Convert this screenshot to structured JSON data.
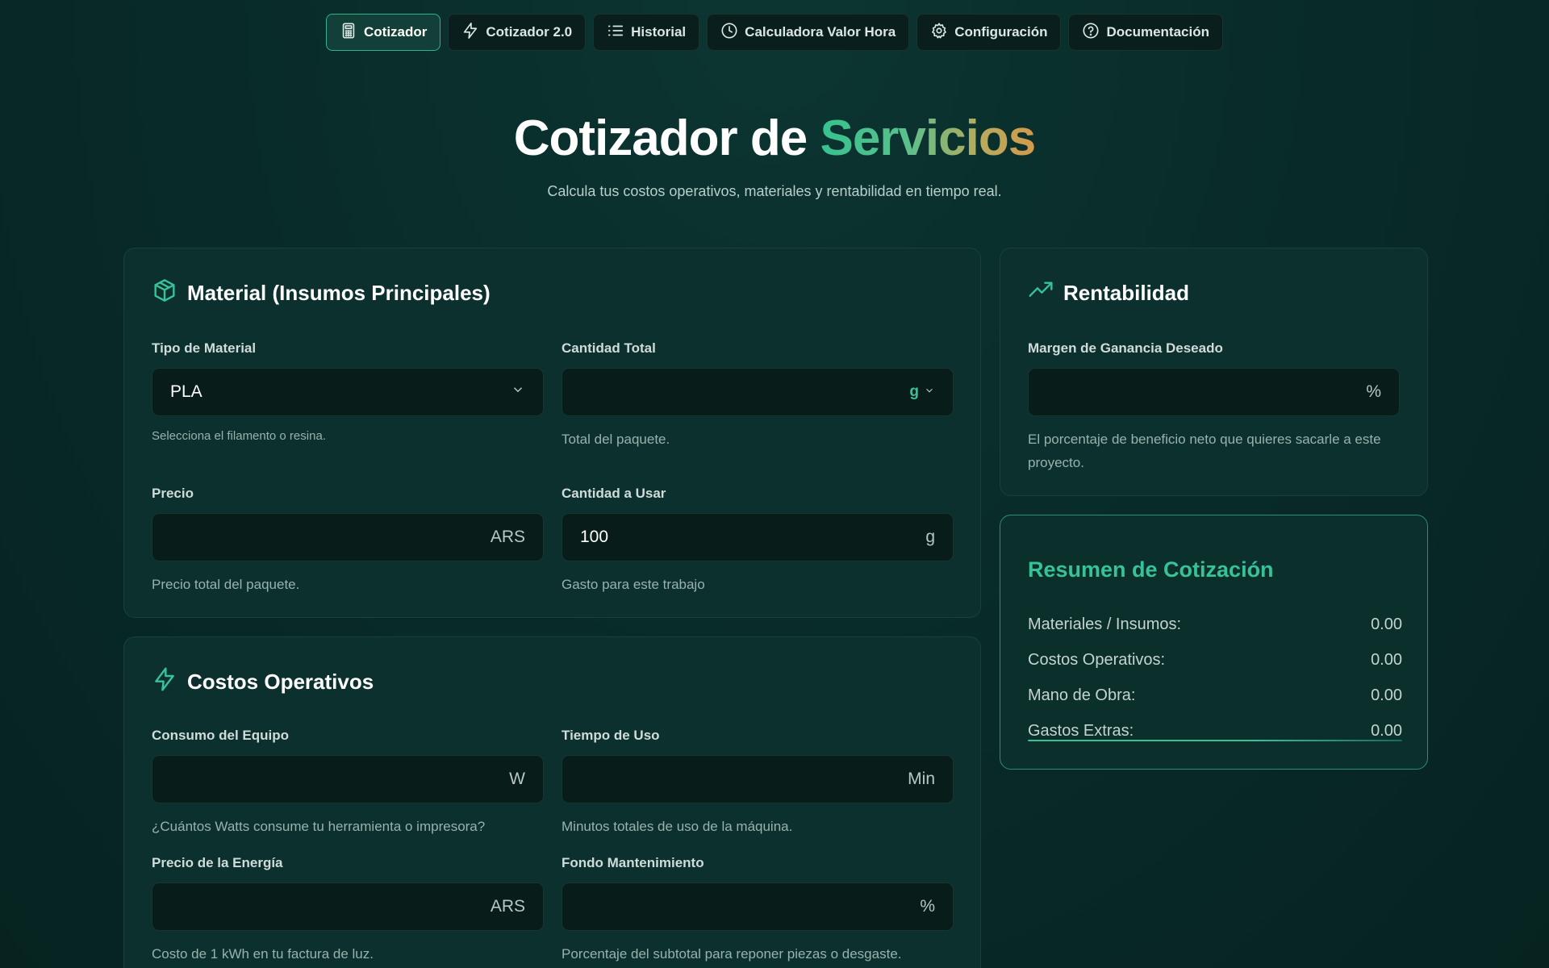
{
  "nav": [
    {
      "label": "Cotizador",
      "icon": "calculator-icon",
      "active": true
    },
    {
      "label": "Cotizador 2.0",
      "icon": "lightning-icon",
      "active": false
    },
    {
      "label": "Historial",
      "icon": "list-icon",
      "active": false
    },
    {
      "label": "Calculadora Valor Hora",
      "icon": "clock-icon",
      "active": false
    },
    {
      "label": "Configuración",
      "icon": "gear-icon",
      "active": false
    },
    {
      "label": "Documentación",
      "icon": "help-circle-icon",
      "active": false
    }
  ],
  "hero": {
    "title_main": "Cotizador de ",
    "title_accent": "Servicios",
    "subtitle": "Calcula tus costos operativos, materiales y rentabilidad en tiempo real."
  },
  "material": {
    "title": "Material (Insumos Principales)",
    "tipo": {
      "label": "Tipo de Material",
      "value": "PLA",
      "help": "Selecciona el filamento o resina."
    },
    "cantidad_total": {
      "label": "Cantidad Total",
      "value": "",
      "unit": "g",
      "help": "Total del paquete."
    },
    "precio": {
      "label": "Precio",
      "value": "",
      "unit": "ARS",
      "help": "Precio total del paquete."
    },
    "cantidad_usar": {
      "label": "Cantidad a Usar",
      "value": "100",
      "unit": "g",
      "help": "Gasto para este trabajo"
    }
  },
  "operativos": {
    "title": "Costos Operativos",
    "consumo": {
      "label": "Consumo del Equipo",
      "value": "",
      "unit": "W",
      "help": "¿Cuántos Watts consume tu herramienta o impresora?"
    },
    "tiempo": {
      "label": "Tiempo de Uso",
      "value": "",
      "unit": "Min",
      "help": "Minutos totales de uso de la máquina."
    },
    "precio_energia": {
      "label": "Precio de la Energía",
      "value": "",
      "unit": "ARS",
      "help": "Costo de 1 kWh en tu factura de luz."
    },
    "fondo": {
      "label": "Fondo Mantenimiento",
      "value": "",
      "unit": "%",
      "help": "Porcentaje del subtotal para reponer piezas o desgaste."
    }
  },
  "rentabilidad": {
    "title": "Rentabilidad",
    "margen": {
      "label": "Margen de Ganancia Deseado",
      "value": "",
      "unit": "%",
      "help": "El porcentaje de beneficio neto que quieres sacarle a este proyecto."
    }
  },
  "resumen": {
    "title": "Resumen de Cotización",
    "rows": [
      {
        "label": "Materiales / Insumos:",
        "value": "0.00"
      },
      {
        "label": "Costos Operativos:",
        "value": "0.00"
      },
      {
        "label": "Mano de Obra:",
        "value": "0.00"
      },
      {
        "label": "Gastos Extras:",
        "value": "0.00"
      }
    ]
  },
  "colors": {
    "accent": "#37c29a",
    "background": "#082a28",
    "card": "#0c302d",
    "input": "#081c1a"
  }
}
